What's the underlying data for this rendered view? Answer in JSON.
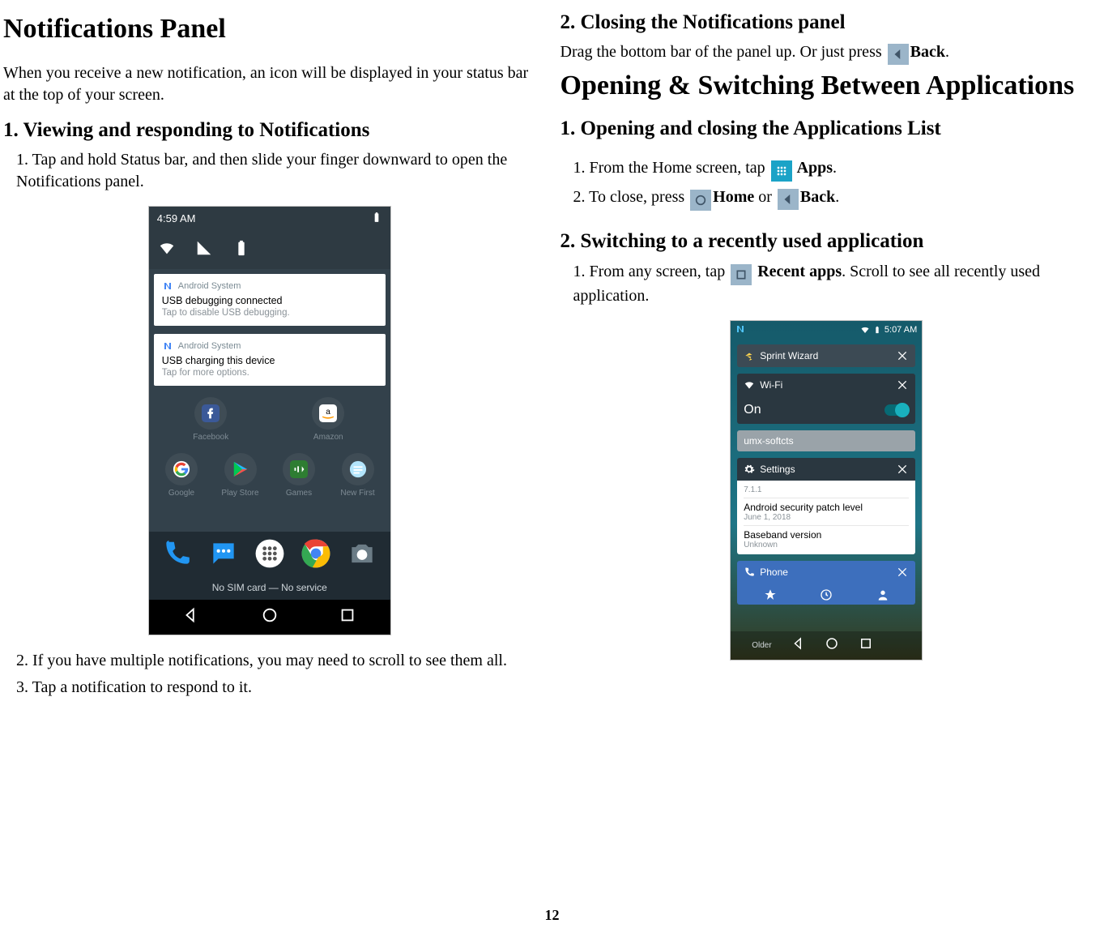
{
  "page_number": "12",
  "left": {
    "h1": "Notifications Panel",
    "intro": "When you receive a new notification, an icon will be displayed in your status bar at the top of your screen.",
    "sec1_title": "1. Viewing and responding to Notifications",
    "sec1_item1": "1. Tap and hold Status bar, and then slide your finger downward to open the Notifications panel.",
    "sec1_item2": "2. If you have multiple notifications, you may need to scroll to see them all.",
    "sec1_item3": "3. Tap a notification to respond to it."
  },
  "right": {
    "sec2_title": "2. Closing the Notifications panel",
    "sec2_body_a": "Drag the bottom bar of the panel up. Or just press ",
    "sec2_body_b": "Back",
    "sec2_body_c": ".",
    "h1": "Opening & Switching Between Applications",
    "secA_title": "1. Opening and closing the Applications List",
    "secA_item1_a": "1. From the Home screen, tap  ",
    "secA_item1_b": " Apps",
    "secA_item1_c": ".",
    "secA_item2_a": "2. To close, press  ",
    "secA_item2_home": "Home",
    "secA_item2_or": " or  ",
    "secA_item2_back": "Back",
    "secA_item2_end": ".",
    "secB_title": "2. Switching to a recently used application",
    "secB_item1_a": "1. From any screen, tap ",
    "secB_item1_b": " Recent apps",
    "secB_item1_c": ". Scroll to see all recently used application."
  },
  "shot1": {
    "time": "4:59 AM",
    "notif1": {
      "app": "Android System",
      "title": "USB debugging connected",
      "sub": "Tap to disable USB debugging."
    },
    "notif2": {
      "app": "Android System",
      "title": "USB charging this device",
      "sub": "Tap for more options."
    },
    "tiles": [
      "Facebook",
      "Amazon",
      "Google",
      "Play Store",
      "Games",
      "New First"
    ],
    "no_sim": "No SIM card — No service"
  },
  "shot2": {
    "time": "5:07 AM",
    "cards": {
      "sprint": "Sprint Wizard",
      "wifi": "Wi-Fi",
      "wifi_state": "On",
      "umx": "umx-softcts",
      "settings": "Settings",
      "ver": "7.1.1",
      "patch_title": "Android security patch level",
      "patch_date": "June 1, 2018",
      "baseband_title": "Baseband version",
      "baseband_val": "Unknown",
      "phone": "Phone",
      "older": "Older"
    }
  }
}
